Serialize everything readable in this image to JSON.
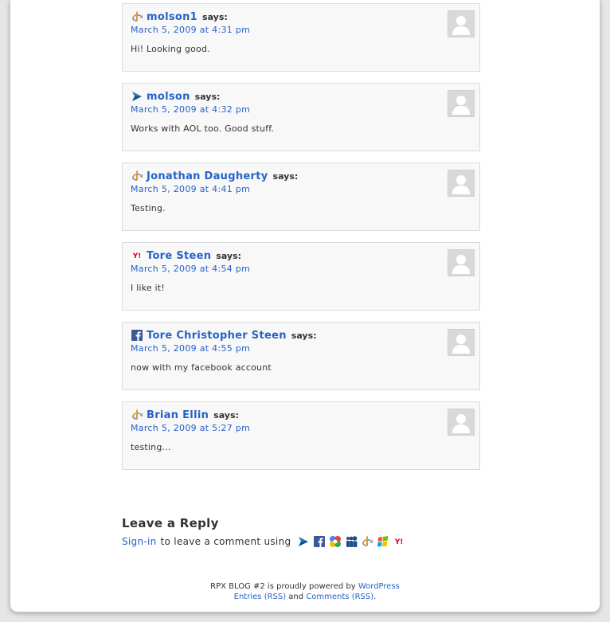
{
  "comments": [
    {
      "author": "molson1",
      "says": "says:",
      "date": "March 5, 2009 at 4:31 pm",
      "text": "Hi! Looking good.",
      "provider_icon": "openid-icon"
    },
    {
      "author": "molson",
      "says": "says:",
      "date": "March 5, 2009 at 4:32 pm",
      "text": "Works with AOL too. Good stuff.",
      "provider_icon": "aol-icon"
    },
    {
      "author": "Jonathan Daugherty",
      "says": "says:",
      "date": "March 5, 2009 at 4:41 pm",
      "text": "Testing.",
      "provider_icon": "openid-icon"
    },
    {
      "author": "Tore Steen",
      "says": "says:",
      "date": "March 5, 2009 at 4:54 pm",
      "text": "I like it!",
      "provider_icon": "yahoo-icon"
    },
    {
      "author": "Tore Christopher Steen",
      "says": "says:",
      "date": "March 5, 2009 at 4:55 pm",
      "text": "now with my facebook account",
      "provider_icon": "facebook-icon"
    },
    {
      "author": "Brian Ellin",
      "says": "says:",
      "date": "March 5, 2009 at 5:27 pm",
      "text": "testing...",
      "provider_icon": "openid-icon"
    }
  ],
  "reply": {
    "title": "Leave a Reply",
    "signin": "Sign-in",
    "text": "to leave a comment using",
    "providers": [
      "aol-icon",
      "facebook-icon",
      "google-icon",
      "myspace-icon",
      "openid-icon",
      "windows-live-icon",
      "yahoo-icon"
    ]
  },
  "footer": {
    "line1_pre": "RPX BLOG #2 is proudly powered by",
    "wordpress": "WordPress",
    "entries": "Entries (RSS)",
    "and": "and",
    "comments_rss": "Comments (RSS)",
    "period": "."
  },
  "colors": {
    "link": "#2563c9",
    "text": "#333333",
    "comment_bg": "#f8f8f8"
  }
}
